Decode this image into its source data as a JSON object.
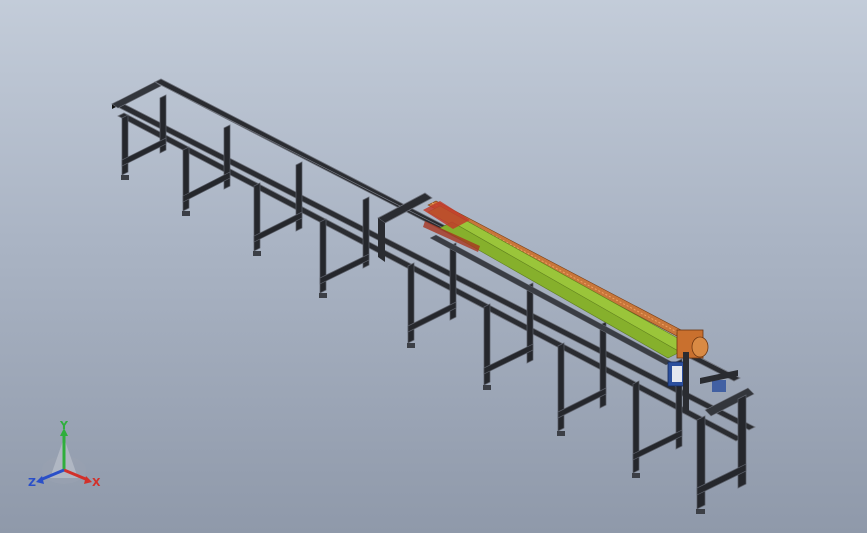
{
  "viewport": {
    "background_top": "#c3ccd9",
    "background_bottom": "#8f99aa"
  },
  "model": {
    "frame_color": "#2a2c31",
    "frame_highlight": "#6e727c",
    "conveyor_color": "#9ac53a",
    "rack_color": "#c8763a",
    "motor_color": "#c9702e",
    "accent_blue": "#2b4f9e"
  },
  "triad": {
    "x_label": "X",
    "y_label": "Y",
    "z_label": "Z",
    "x_color": "#d2302a",
    "y_color": "#2fae3c",
    "z_color": "#2a4fc8",
    "icons": [
      "axis-triad-icon"
    ]
  }
}
